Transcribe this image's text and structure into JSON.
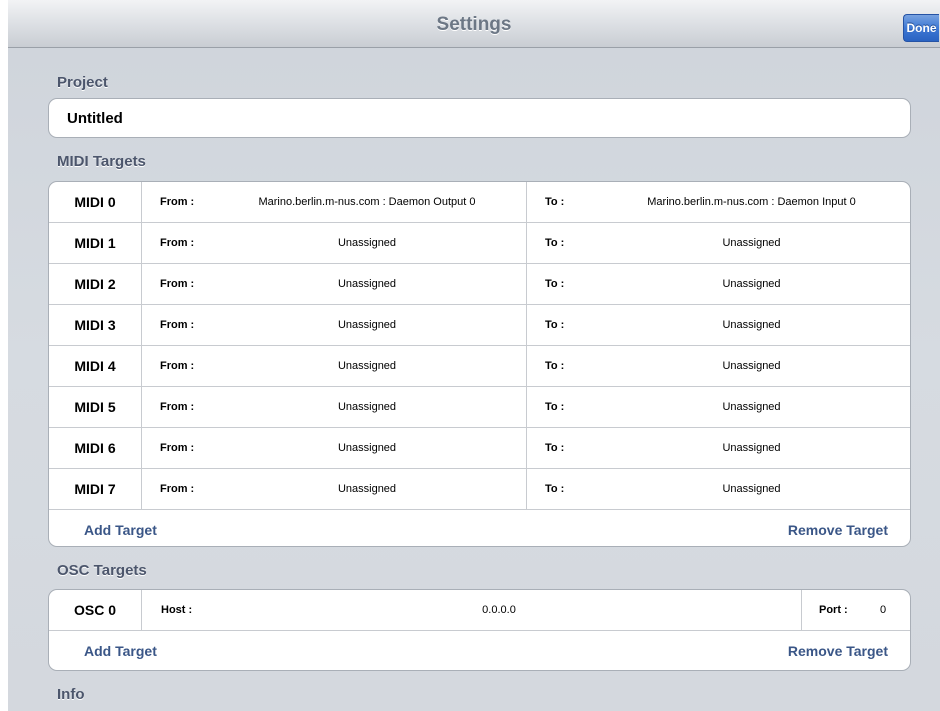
{
  "navbar": {
    "title": "Settings",
    "done_label": "Done"
  },
  "project": {
    "header": "Project",
    "name": "Untitled"
  },
  "midi": {
    "header": "MIDI Targets",
    "from_label": "From :",
    "to_label": "To :",
    "targets": [
      {
        "name": "MIDI 0",
        "from": "Marino.berlin.m-nus.com : Daemon Output 0",
        "to": "Marino.berlin.m-nus.com : Daemon Input 0"
      },
      {
        "name": "MIDI 1",
        "from": "Unassigned",
        "to": "Unassigned"
      },
      {
        "name": "MIDI 2",
        "from": "Unassigned",
        "to": "Unassigned"
      },
      {
        "name": "MIDI 3",
        "from": "Unassigned",
        "to": "Unassigned"
      },
      {
        "name": "MIDI 4",
        "from": "Unassigned",
        "to": "Unassigned"
      },
      {
        "name": "MIDI 5",
        "from": "Unassigned",
        "to": "Unassigned"
      },
      {
        "name": "MIDI 6",
        "from": "Unassigned",
        "to": "Unassigned"
      },
      {
        "name": "MIDI 7",
        "from": "Unassigned",
        "to": "Unassigned"
      }
    ],
    "add_label": "Add Target",
    "remove_label": "Remove Target"
  },
  "osc": {
    "header": "OSC Targets",
    "host_label": "Host :",
    "port_label": "Port :",
    "targets": [
      {
        "name": "OSC 0",
        "host": "0.0.0.0",
        "port": "0"
      }
    ],
    "add_label": "Add Target",
    "remove_label": "Remove Target"
  },
  "info": {
    "header": "Info"
  },
  "colors": {
    "nav_title": "#6c7785",
    "section_header": "#4c566c",
    "action_text": "#3a5687",
    "done_button": "#3e78d4"
  }
}
